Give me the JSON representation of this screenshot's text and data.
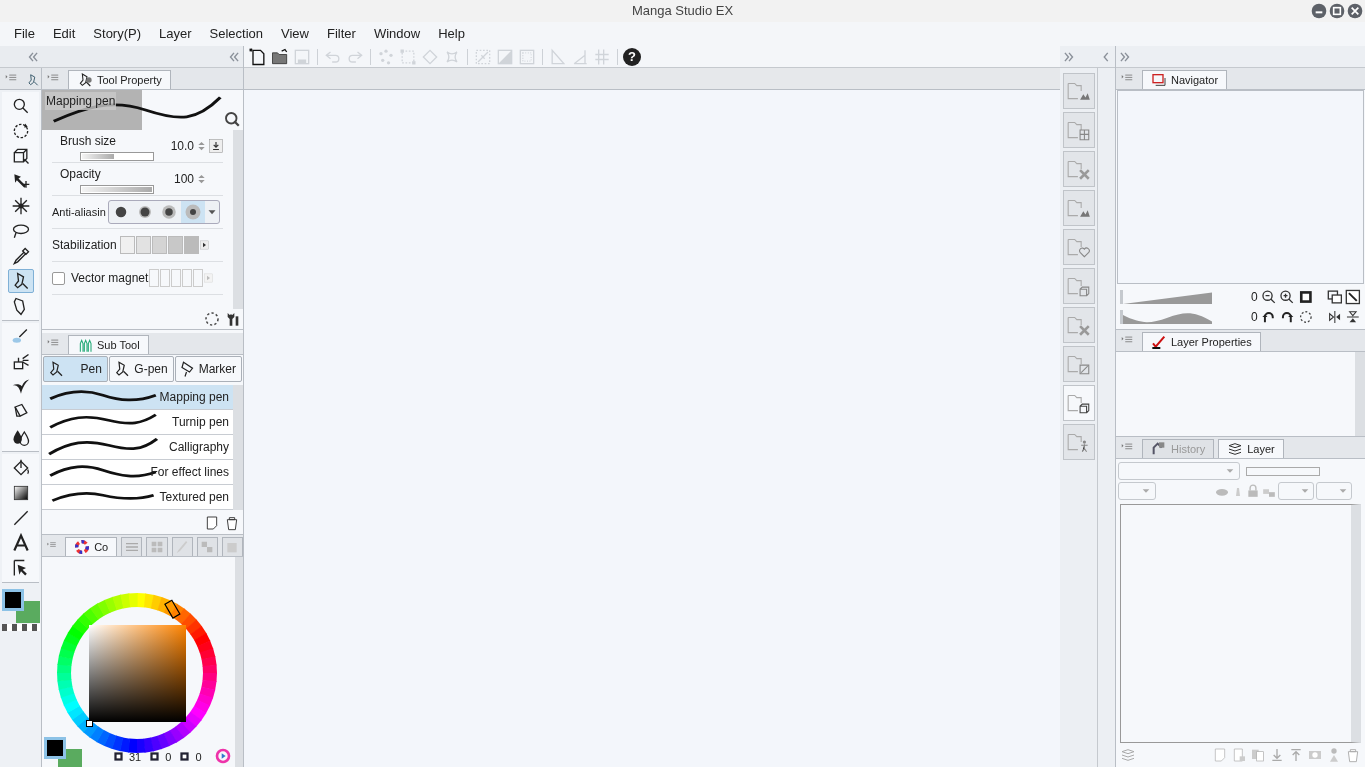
{
  "window": {
    "title": "Manga Studio EX"
  },
  "menu": [
    "File",
    "Edit",
    "Story(P)",
    "Layer",
    "Selection",
    "View",
    "Filter",
    "Window",
    "Help"
  ],
  "toolbar": [
    {
      "kind": "new",
      "disabled": false
    },
    {
      "kind": "open",
      "disabled": false
    },
    {
      "kind": "save",
      "disabled": true
    },
    {
      "kind": "sep"
    },
    {
      "kind": "undo",
      "disabled": true
    },
    {
      "kind": "redo",
      "disabled": true
    },
    {
      "kind": "sep"
    },
    {
      "kind": "dots",
      "disabled": true
    },
    {
      "kind": "frame",
      "disabled": true
    },
    {
      "kind": "bucket",
      "disabled": true
    },
    {
      "kind": "transform",
      "disabled": true
    },
    {
      "kind": "sep"
    },
    {
      "kind": "cross",
      "disabled": true
    },
    {
      "kind": "half",
      "disabled": true
    },
    {
      "kind": "dotted",
      "disabled": true
    },
    {
      "kind": "sep"
    },
    {
      "kind": "ruler",
      "disabled": true
    },
    {
      "kind": "angle",
      "disabled": true
    },
    {
      "kind": "grid",
      "disabled": true
    },
    {
      "kind": "sep"
    },
    {
      "kind": "help",
      "disabled": false,
      "label": "?"
    }
  ],
  "toolbox": [
    [
      {
        "kind": "zoom",
        "selected": false
      },
      {
        "kind": "rotate",
        "selected": false
      },
      {
        "kind": "object",
        "selected": false
      },
      {
        "kind": "move",
        "selected": false
      },
      {
        "kind": "wand",
        "selected": false
      },
      {
        "kind": "lasso",
        "selected": false
      },
      {
        "kind": "dropper",
        "selected": false
      },
      {
        "kind": "pen",
        "selected": true
      },
      {
        "kind": "pencil",
        "selected": false
      }
    ],
    [
      {
        "kind": "brush",
        "selected": false
      },
      {
        "kind": "airbrush",
        "selected": false
      },
      {
        "kind": "decoration",
        "selected": false
      },
      {
        "kind": "eraser",
        "selected": false
      },
      {
        "kind": "blend",
        "selected": false
      }
    ],
    [
      {
        "kind": "fill",
        "selected": false
      },
      {
        "kind": "gradient",
        "selected": false
      },
      {
        "kind": "line",
        "selected": false
      },
      {
        "kind": "text",
        "selected": false
      },
      {
        "kind": "select",
        "selected": false
      }
    ]
  ],
  "tool_property": {
    "tab": "Tool Property",
    "preview_name": "Mapping pen",
    "rows": [
      {
        "kind": "slider",
        "label": "Brush size",
        "value": "10.0",
        "level": 0.45
      },
      {
        "kind": "slider",
        "label": "Opacity",
        "value": "100",
        "level": 1
      },
      {
        "kind": "antialias",
        "label": "Anti-aliasin",
        "options": [
          {
            "selected": false
          },
          {
            "selected": false
          },
          {
            "selected": false
          },
          {
            "selected": true
          }
        ]
      },
      {
        "kind": "stabilization",
        "label": "Stabilization"
      },
      {
        "kind": "checkbox",
        "label": "Vector magnet",
        "checked": false
      }
    ]
  },
  "sub_tool": {
    "tab": "Sub Tool",
    "groups": [
      {
        "label": "Pen",
        "selected": true
      },
      {
        "label": "G-pen",
        "selected": false
      },
      {
        "label": "Marker",
        "selected": false
      }
    ],
    "items": [
      {
        "label": "Mapping pen",
        "selected": true
      },
      {
        "label": "Turnip pen",
        "selected": false
      },
      {
        "label": "Calligraphy",
        "selected": false
      },
      {
        "label": "For effect lines",
        "selected": false
      },
      {
        "label": "Textured pen",
        "selected": false
      }
    ]
  },
  "color": {
    "tab": "Co",
    "h": "31",
    "s": "0",
    "v": "0"
  },
  "navigator": {
    "tab": "Navigator",
    "zoom": "0",
    "rotation": "0",
    "zoom_slider": {
      "level": 1
    },
    "rotation_slider": {
      "level": 1
    }
  },
  "layer_properties": {
    "tab": "Layer Properties"
  },
  "layer_panel": {
    "opacity_slider": {
      "level": 0
    },
    "tabs": [
      {
        "label": "History",
        "selected": false
      },
      {
        "label": "Layer",
        "selected": true
      }
    ]
  }
}
